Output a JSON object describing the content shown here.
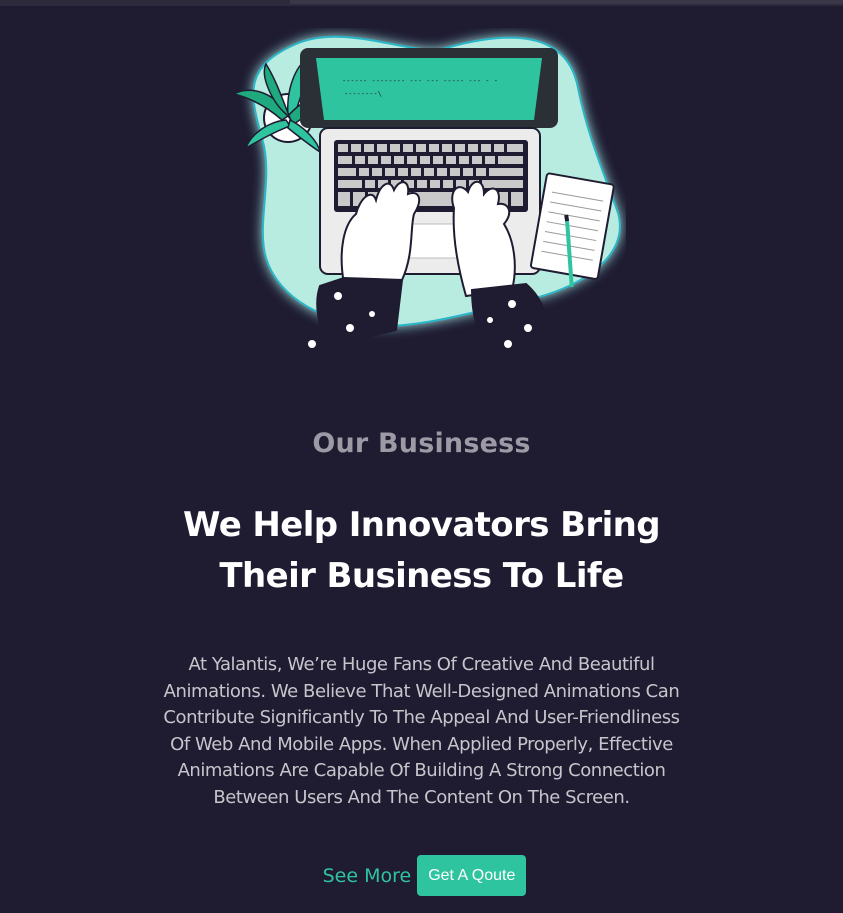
{
  "hero": {
    "image_name": "laptop-typing-illustration",
    "screen_text": [
      "------ -------- --- ---    ----- --- - -",
      "--------\\"
    ]
  },
  "section": {
    "eyebrow": "Our Businsess",
    "headline_lines": [
      "We Help Innovators Bring",
      "Their Business To Life"
    ],
    "body_lines": [
      "At Yalantis, We’re Huge Fans Of Creative And Beautiful",
      "Animations. We Believe That Well-Designed Animations Can",
      "Contribute Significantly To The Appeal And User-Friendliness",
      "Of Web And Mobile Apps. When Applied Properly, Effective",
      "Animations Are Capable Of Building A Strong Connection",
      "Between Users And The Content On The Screen."
    ]
  },
  "actions": {
    "see_more_label": "See More",
    "quote_label": "Get A Qoute"
  },
  "colors": {
    "background": "#1f1b31",
    "accent": "#2fc4a0",
    "blob": "#b8ece0",
    "eyebrow": "#9d9aa6",
    "body": "#c7c5cc"
  }
}
